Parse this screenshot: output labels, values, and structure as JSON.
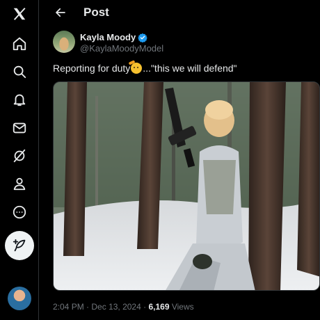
{
  "sidebar": {
    "items": [
      {
        "name": "x-logo-icon"
      },
      {
        "name": "home-icon"
      },
      {
        "name": "search-icon"
      },
      {
        "name": "notifications-icon"
      },
      {
        "name": "messages-icon"
      },
      {
        "name": "grok-icon"
      },
      {
        "name": "profile-icon"
      },
      {
        "name": "more-icon"
      }
    ],
    "post_button_icon": "feather-plus-icon"
  },
  "header": {
    "title": "Post"
  },
  "tweet": {
    "author_name": "Kayla Moody",
    "author_handle": "@KaylaMoodyModel",
    "text_before_emoji": "Reporting for duty",
    "emoji": "saluting-face",
    "text_after_emoji": "...\"this we will defend\"",
    "time": "2:04 PM",
    "date": "Dec 13, 2024",
    "views_count": "6,169",
    "views_label": "Views"
  },
  "colors": {
    "background": "#000000",
    "text": "#e7e9ea",
    "secondary_text": "#71767b",
    "verified_blue": "#1d9bf0",
    "border": "#2f3336"
  }
}
